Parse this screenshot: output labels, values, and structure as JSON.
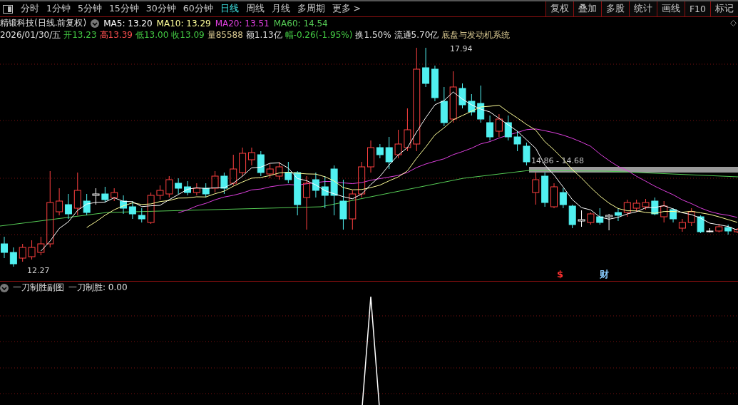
{
  "toolbar": {
    "tabs": [
      {
        "label": "分时",
        "selected": false
      },
      {
        "label": "1分钟",
        "selected": false
      },
      {
        "label": "5分钟",
        "selected": false
      },
      {
        "label": "15分钟",
        "selected": false
      },
      {
        "label": "30分钟",
        "selected": false
      },
      {
        "label": "60分钟",
        "selected": false
      },
      {
        "label": "日线",
        "selected": true
      },
      {
        "label": "周线",
        "selected": false
      },
      {
        "label": "月线",
        "selected": false
      },
      {
        "label": "多周期",
        "selected": false
      },
      {
        "label": "更多 >",
        "selected": false
      }
    ],
    "buttons": [
      "复权",
      "叠加",
      "多股",
      "统计",
      "画线",
      "F10",
      "标记"
    ]
  },
  "chart_title": "精锻科技(日线.前复权)",
  "moving_averages": [
    {
      "label": "MA5: 13.20",
      "color": "#ffffff"
    },
    {
      "label": "MA10: 13.29",
      "color": "#ffff99"
    },
    {
      "label": "MA20: 13.51",
      "color": "#e040e0"
    },
    {
      "label": "MA60: 14.54",
      "color": "#55cc55"
    }
  ],
  "quote": [
    {
      "text": "2026/01/30/五",
      "color": "#e0e0e0"
    },
    {
      "text": "开13.23",
      "color": "#44cc44"
    },
    {
      "text": "高13.39",
      "color": "#ff5050"
    },
    {
      "text": "低13.00",
      "color": "#44cc44"
    },
    {
      "text": "收13.09",
      "color": "#44cc44"
    },
    {
      "text": "量85588",
      "color": "#d8c890"
    },
    {
      "text": "额1.13亿",
      "color": "#e0e0e0"
    },
    {
      "text": "幅-0.26(-1.95%)",
      "color": "#44cc44"
    },
    {
      "text": "换1.50%",
      "color": "#e0e0e0"
    },
    {
      "text": "流通5.70亿",
      "color": "#e0e0e0"
    },
    {
      "text": "底盘与发动机系统",
      "color": "#d8c890"
    }
  ],
  "price_labels": {
    "high": "17.94",
    "low": "12.27",
    "range": "14.86 - 14.68"
  },
  "event_markers": [
    {
      "text": "$",
      "color": "#ff3030"
    },
    {
      "text": "财",
      "color": "#88ccff"
    }
  ],
  "sub_chart": {
    "title": "一刀制胜副图",
    "reading": "一刀制胜: 0.00"
  }
}
